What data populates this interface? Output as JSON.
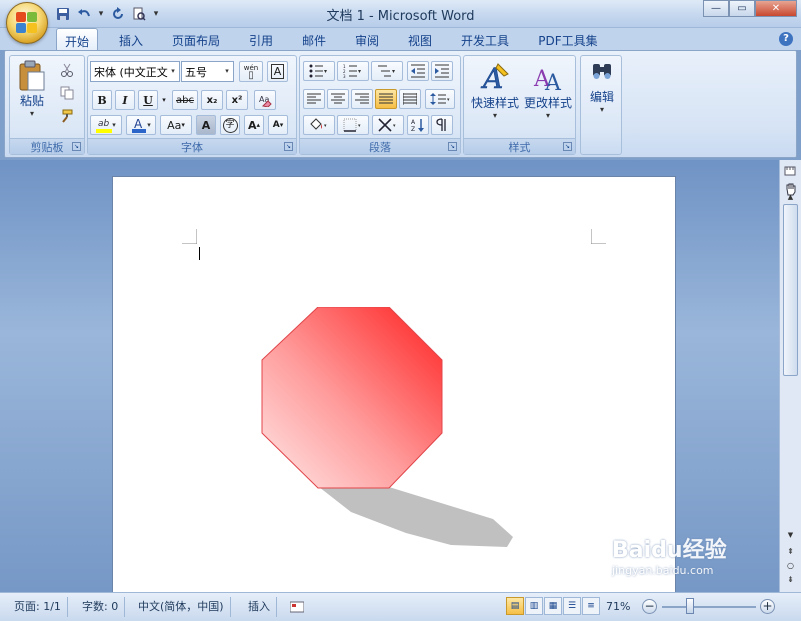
{
  "window": {
    "title": "文档 1 - Microsoft Word",
    "minimize": "—",
    "maximize": "▭",
    "close": "✕"
  },
  "tabs": [
    {
      "label": "开始",
      "active": true
    },
    {
      "label": "插入"
    },
    {
      "label": "页面布局"
    },
    {
      "label": "引用"
    },
    {
      "label": "邮件"
    },
    {
      "label": "审阅"
    },
    {
      "label": "视图"
    },
    {
      "label": "开发工具"
    },
    {
      "label": "PDF工具集"
    }
  ],
  "help_label": "?",
  "clipboard": {
    "group_label": "剪贴板",
    "paste_label": "粘贴"
  },
  "font": {
    "group_label": "字体",
    "font_name": "宋体 (中文正文",
    "font_size": "五号",
    "bold": "B",
    "italic": "I",
    "underline": "U",
    "strike": "abc",
    "subscript": "x₂",
    "superscript": "x²",
    "grow": "A",
    "shrink": "A",
    "case": "Aa",
    "char_border": "A",
    "phonetic": "wén"
  },
  "paragraph": {
    "group_label": "段落"
  },
  "styles": {
    "group_label": "样式",
    "quick_styles": "快速样式",
    "change_styles": "更改样式"
  },
  "editing": {
    "label": "编辑"
  },
  "status": {
    "page": "页面: 1/1",
    "words": "字数: 0",
    "language": "中文(简体，中国)",
    "mode": "插入",
    "zoom": "71%",
    "zoom_out": "−",
    "zoom_in": "+"
  },
  "watermark": {
    "brand": "Baidu经验",
    "url": "jingyan.baidu.com"
  },
  "colors": {
    "ribbon_bg": "#dbe7f6",
    "accent": "#15428b",
    "shape_dark": "#ff3030",
    "shape_light": "#ffe0e0",
    "shadow": "#c0c0c0"
  }
}
